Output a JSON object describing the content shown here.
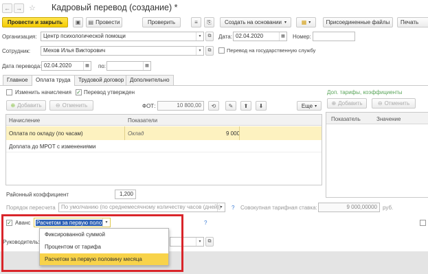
{
  "window": {
    "title": "Кадровый перевод (создание) *",
    "modified_star": "☆"
  },
  "toolbar": {
    "post_close": "Провести и закрыть",
    "post": "Провести",
    "check": "Проверить",
    "create_based": "Создать на основании",
    "attached_files": "Присоединенные файлы",
    "print": "Печать"
  },
  "header": {
    "org_label": "Организация:",
    "org_value": "Центр психологической помощи",
    "date_label": "Дата:",
    "date_value": "02.04.2020",
    "number_label": "Номер:",
    "number_value": "",
    "employee_label": "Сотрудник:",
    "employee_value": "Мехов Илья Викторович",
    "civil_service_label": "Перевод на государственную службу",
    "transfer_date_label": "Дата перевода:",
    "transfer_date_value": "02.04.2020",
    "to_label": "по:",
    "to_value": ""
  },
  "tabs": [
    "Главное",
    "Оплата труда",
    "Трудовой договор",
    "Дополнительно"
  ],
  "pay": {
    "change_accruals": "Изменить начисления",
    "transfer_approved": "Перевод утвержден",
    "add": "Добавить",
    "cancel": "Отменить",
    "fot_label": "ФОТ:",
    "fot_value": "10 800,00",
    "more": "Еще",
    "col_accrual": "Начисление",
    "col_indicators": "Показатели",
    "rows": [
      {
        "name": "Оплата по окладу (по часам)",
        "indicator": "Оклад",
        "value": "9 000"
      },
      {
        "name": "Доплата до МРОТ с изменениями",
        "indicator": "",
        "value": ""
      }
    ],
    "district_coef_label": "Районный коэффициент",
    "district_coef_value": "1,200",
    "recalc_label": "Порядок пересчета",
    "recalc_value": "По умолчанию (по среднемесячному количеству часов (дней))",
    "help": "?",
    "total_rate_label": "Совокупная тарифная ставка:",
    "total_rate_value": "9 000,00000",
    "currency": "руб."
  },
  "right_panel": {
    "title": "Доп. тарифы, коэффициенты",
    "add": "Добавить",
    "cancel": "Отменить",
    "col_indicator": "Показатель",
    "col_value": "Значение"
  },
  "advance": {
    "label": "Аванс",
    "value": "Расчетом за первую поло",
    "help": "?",
    "options": [
      "Фиксированной суммой",
      "Процентом от тарифа",
      "Расчетом за первую половину месяца"
    ]
  },
  "manager_label": "Руководитель:",
  "colors": {
    "highlight": "#d9252a",
    "accent_yellow": "#f5cc00",
    "selected_row": "#fdf2c0"
  }
}
